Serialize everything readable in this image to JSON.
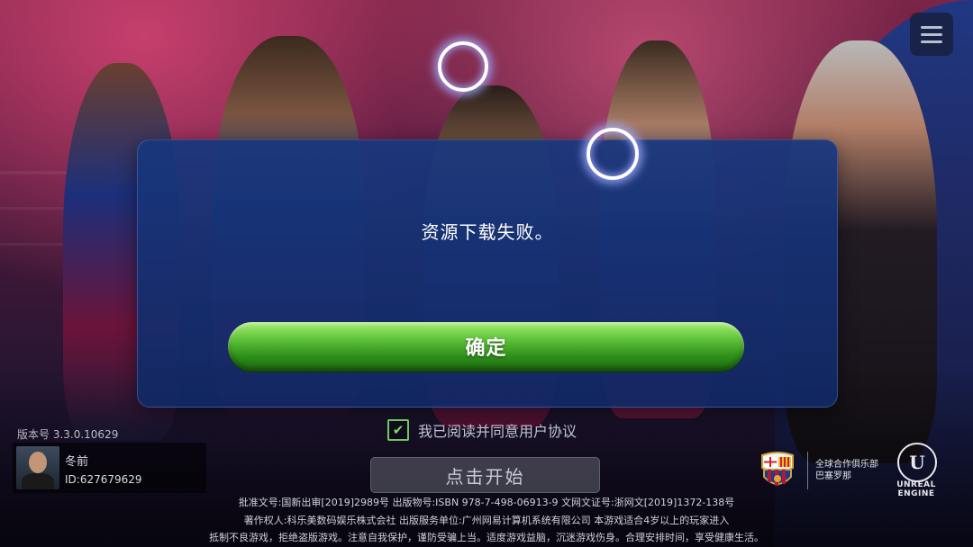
{
  "dialog": {
    "message": "资源下载失败。",
    "confirm_label": "确定"
  },
  "agreement": {
    "checked": true,
    "label": "我已阅读并同意用户协议"
  },
  "start_button": {
    "label": "点击开始"
  },
  "version_label": "版本号 3.3.0.10629",
  "user": {
    "name": "冬前",
    "id": "ID:627679629"
  },
  "partner": {
    "line1": "全球合作俱乐部",
    "line2": "巴塞罗那"
  },
  "engine_logo": {
    "line1": "UNREAL",
    "line2": "ENGINE"
  },
  "legal": {
    "line1": "批准文号:国新出审[2019]2989号 出版物号:ISBN 978-7-498-06913-9 文网文证号:浙网文[2019]1372-138号",
    "line2": "著作权人:科乐美数码娱乐株式会社 出版服务单位:广州网易计算机系统有限公司 本游戏适合4岁以上的玩家进入",
    "line3": "抵制不良游戏，拒绝盗版游戏。注意自我保护，谨防受骗上当。适度游戏益脑，沉迷游戏伤身。合理安排时间，享受健康生活。"
  },
  "icons": {
    "menu": "menu-icon",
    "loading": "loading-ring-icon",
    "crest": "club-crest-icon",
    "engine": "unreal-engine-logo"
  },
  "colors": {
    "dialog_bg": "#1e3a82",
    "confirm_button": "#4fb42e",
    "checkbox_accent": "#6ec85b"
  }
}
